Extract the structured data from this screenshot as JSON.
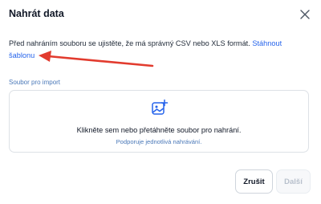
{
  "dialog": {
    "title": "Nahrát data",
    "close_icon": "close-icon"
  },
  "info": {
    "text": "Před nahráním souboru se ujistěte, že má správný CSV nebo XLS formát. ",
    "link_text": "Stáhnout šablonu"
  },
  "import": {
    "section_label": "Soubor pro import",
    "icon": "image-add-icon",
    "main_text": "Klikněte sem nebo přetáhněte soubor pro nahrání.",
    "sub_text": "Podporuje jednotlivá nahrávání."
  },
  "buttons": {
    "cancel_label": "Zrušit",
    "next_label": "Další"
  },
  "colors": {
    "accent": "#2563eb",
    "annotation_arrow": "#e23b2e"
  }
}
